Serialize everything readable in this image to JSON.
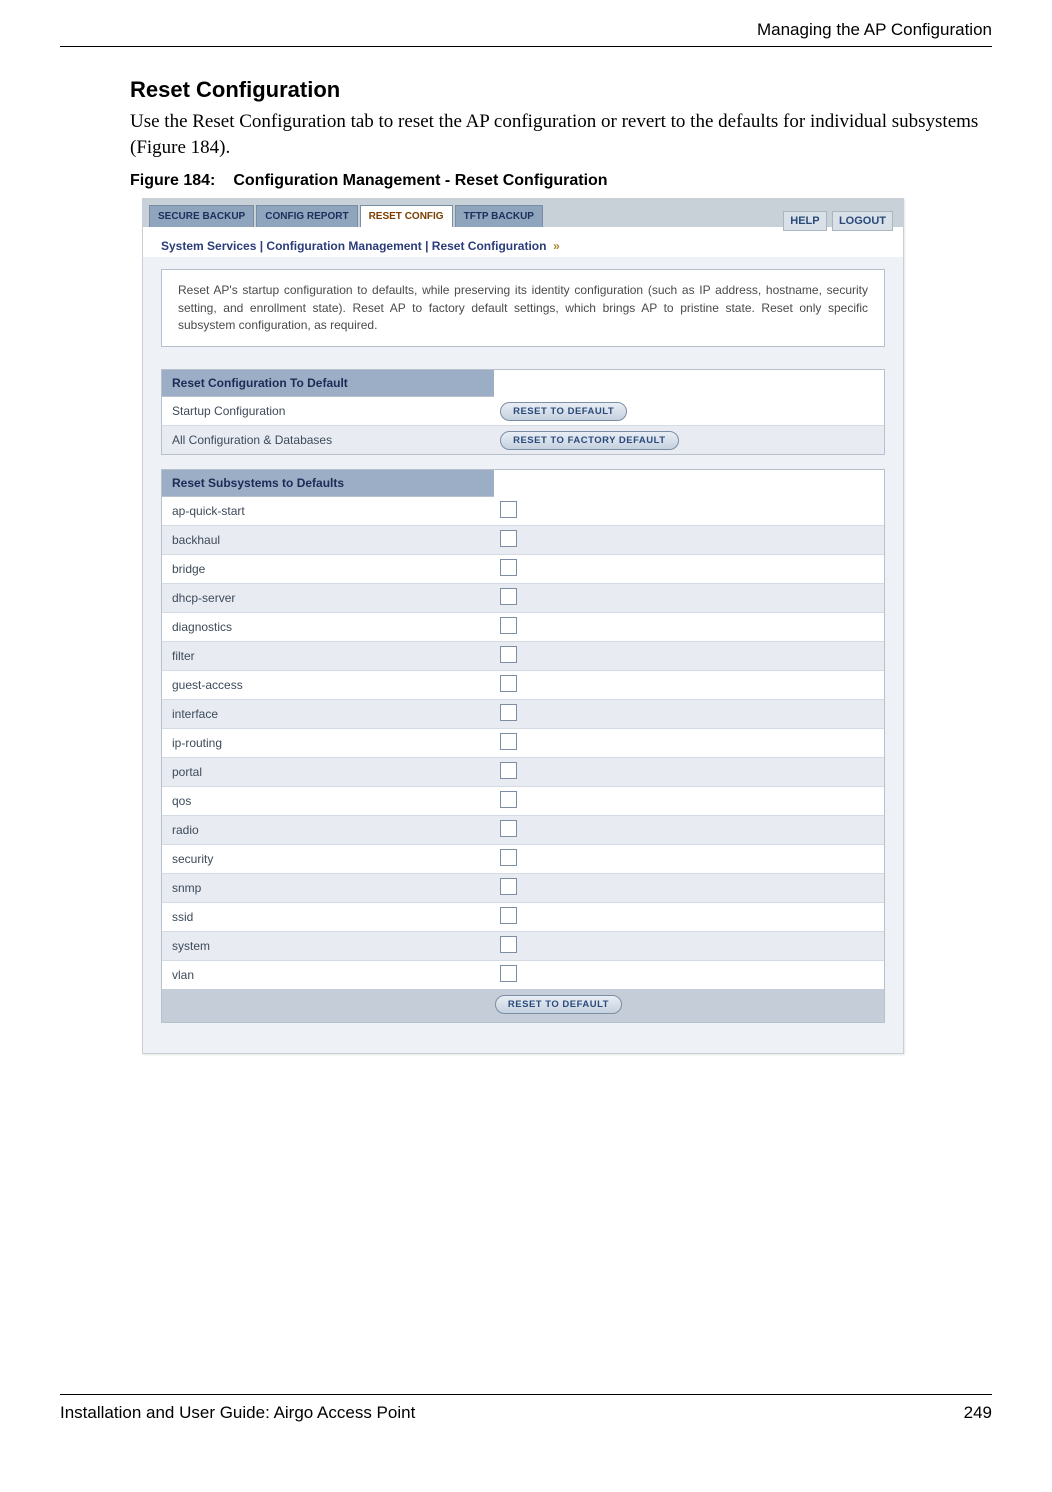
{
  "header": {
    "chapter": "Managing the AP Configuration"
  },
  "section": {
    "title": "Reset Configuration",
    "intro": "Use the Reset Configuration tab to reset the AP configuration or revert to the defaults for individual subsystems (Figure 184).",
    "figure_label": "Figure 184:",
    "figure_title": "Configuration Management - Reset Configuration"
  },
  "screenshot": {
    "tabs": [
      "SECURE BACKUP",
      "CONFIG REPORT",
      "RESET CONFIG",
      "TFTP BACKUP"
    ],
    "active_tab_index": 2,
    "top_links": {
      "help": "HELP",
      "logout": "LOGOUT"
    },
    "breadcrumb": "System Services | Configuration Management | Reset Configuration",
    "description": "Reset AP's startup configuration to defaults, while preserving its identity configuration (such as IP address, hostname, security setting, and enrollment state). Reset AP to factory default settings, which brings AP to pristine state. Reset only specific subsystem configuration, as required.",
    "panel1": {
      "title": "Reset Configuration To Default",
      "rows": [
        {
          "label": "Startup Configuration",
          "button": "RESET TO DEFAULT"
        },
        {
          "label": "All Configuration & Databases",
          "button": "RESET TO FACTORY DEFAULT"
        }
      ]
    },
    "panel2": {
      "title": "Reset Subsystems to Defaults",
      "items": [
        "ap-quick-start",
        "backhaul",
        "bridge",
        "dhcp-server",
        "diagnostics",
        "filter",
        "guest-access",
        "interface",
        "ip-routing",
        "portal",
        "qos",
        "radio",
        "security",
        "snmp",
        "ssid",
        "system",
        "vlan"
      ],
      "footer_button": "RESET TO DEFAULT"
    }
  },
  "footer": {
    "doc_title": "Installation and User Guide: Airgo Access Point",
    "page_number": "249"
  }
}
